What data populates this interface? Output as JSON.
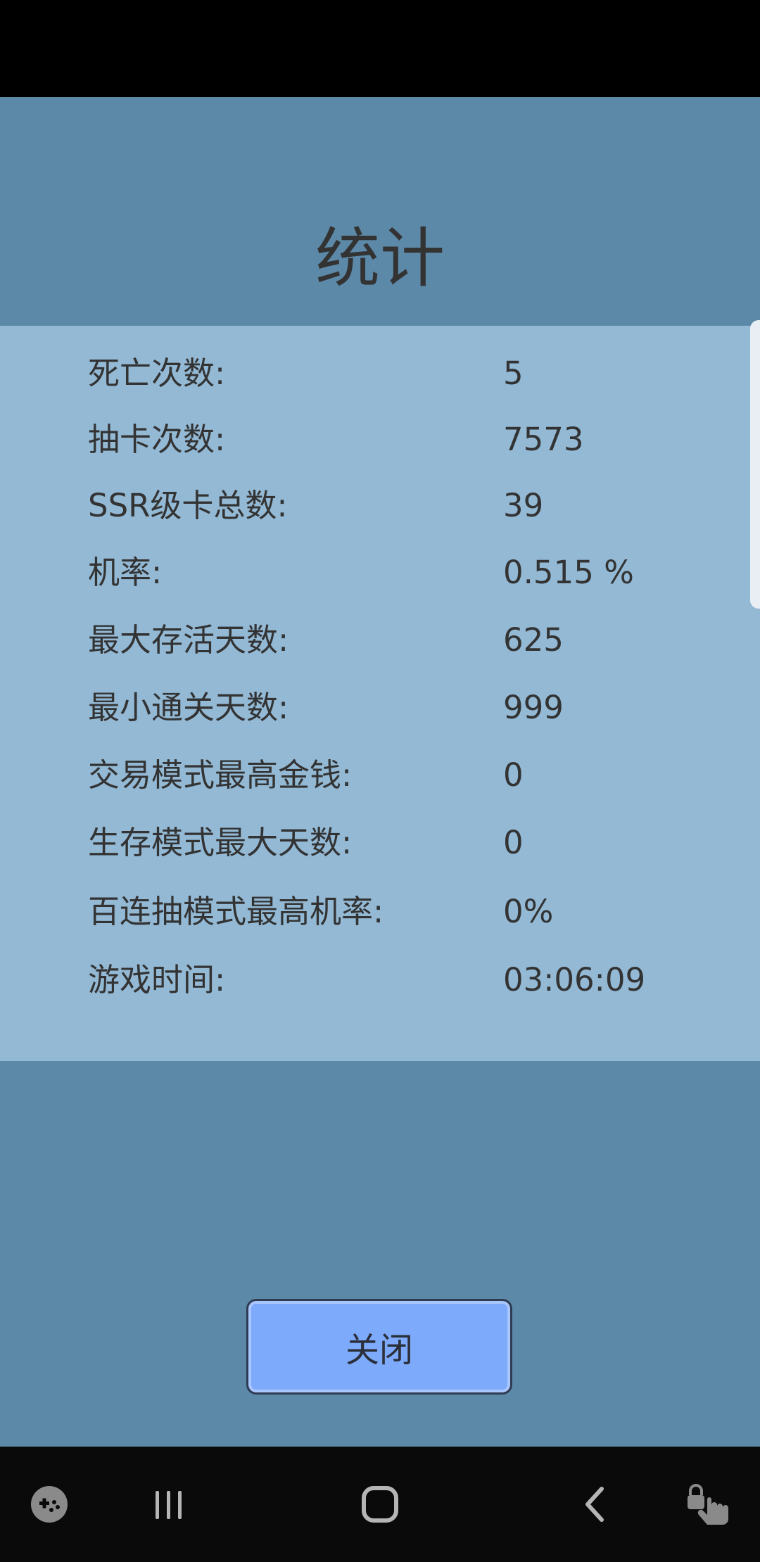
{
  "title": "统计",
  "stats": [
    {
      "label": "死亡次数:",
      "value": "5"
    },
    {
      "label": "抽卡次数:",
      "value": "7573"
    },
    {
      "label": "SSR级卡总数:",
      "value": "39"
    },
    {
      "label": "机率:",
      "value": "0.515 %"
    },
    {
      "label": "最大存活天数:",
      "value": "625"
    },
    {
      "label": "最小通关天数:",
      "value": "999"
    },
    {
      "label": "交易模式最高金钱:",
      "value": "0"
    },
    {
      "label": "生存模式最大天数:",
      "value": "0"
    },
    {
      "label": "百连抽模式最高机率:",
      "value": "0%"
    },
    {
      "label": "游戏时间:",
      "value": "03:06:09"
    }
  ],
  "close_button_label": "关闭",
  "nav": {
    "icons": [
      "game-launcher-icon",
      "recent-apps-icon",
      "home-icon",
      "back-icon",
      "screen-lock-touch-icon"
    ]
  },
  "colors": {
    "background": "#5d89a8",
    "panel": "#93b9d5",
    "button": "#7eaafb",
    "text": "#333333"
  }
}
